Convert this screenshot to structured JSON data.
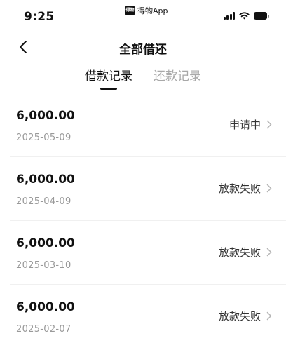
{
  "status_bar": {
    "time": "9:25",
    "app_badge": "得物",
    "app_name": "得物App"
  },
  "nav": {
    "title": "全部借还"
  },
  "tabs": [
    {
      "label": "借款记录",
      "active": true
    },
    {
      "label": "还款记录",
      "active": false
    }
  ],
  "records": [
    {
      "amount": "6,000.00",
      "date": "2025-05-09",
      "status": "申请中"
    },
    {
      "amount": "6,000.00",
      "date": "2025-04-09",
      "status": "放款失败"
    },
    {
      "amount": "6,000.00",
      "date": "2025-03-10",
      "status": "放款失败"
    },
    {
      "amount": "6,000.00",
      "date": "2025-02-07",
      "status": "放款失败"
    }
  ],
  "icons": {
    "back": "chevron-left-icon",
    "row": "chevron-right-icon",
    "signal": "signal-icon",
    "wifi": "wifi-icon",
    "battery": "battery-icon"
  }
}
